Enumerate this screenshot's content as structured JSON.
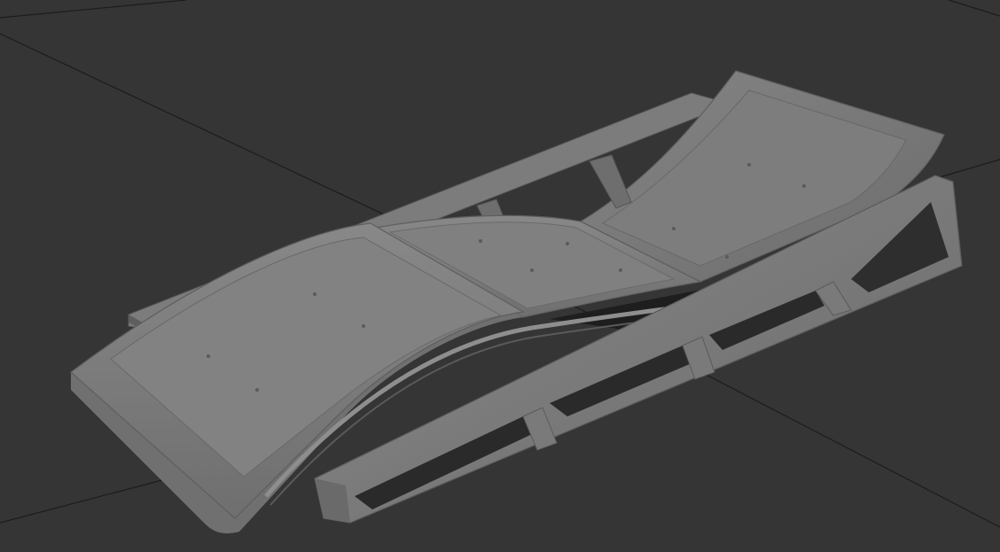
{
  "viewport": {
    "shading": "flat-gray",
    "background_color": "#353535",
    "grid_color": "#1a1a1a",
    "model_base_color": "#7a7a7a",
    "model_highlight_color": "#8e8e8e",
    "model_shadow_color": "#5a5a5a",
    "selection_highlight_color": "#2ec42e"
  },
  "scene": {
    "object": "sun-lounger",
    "parts": [
      "frame-left-rail",
      "frame-right-rail",
      "foot-cushion",
      "seat-cushion",
      "back-cushion",
      "frame-struts"
    ]
  }
}
